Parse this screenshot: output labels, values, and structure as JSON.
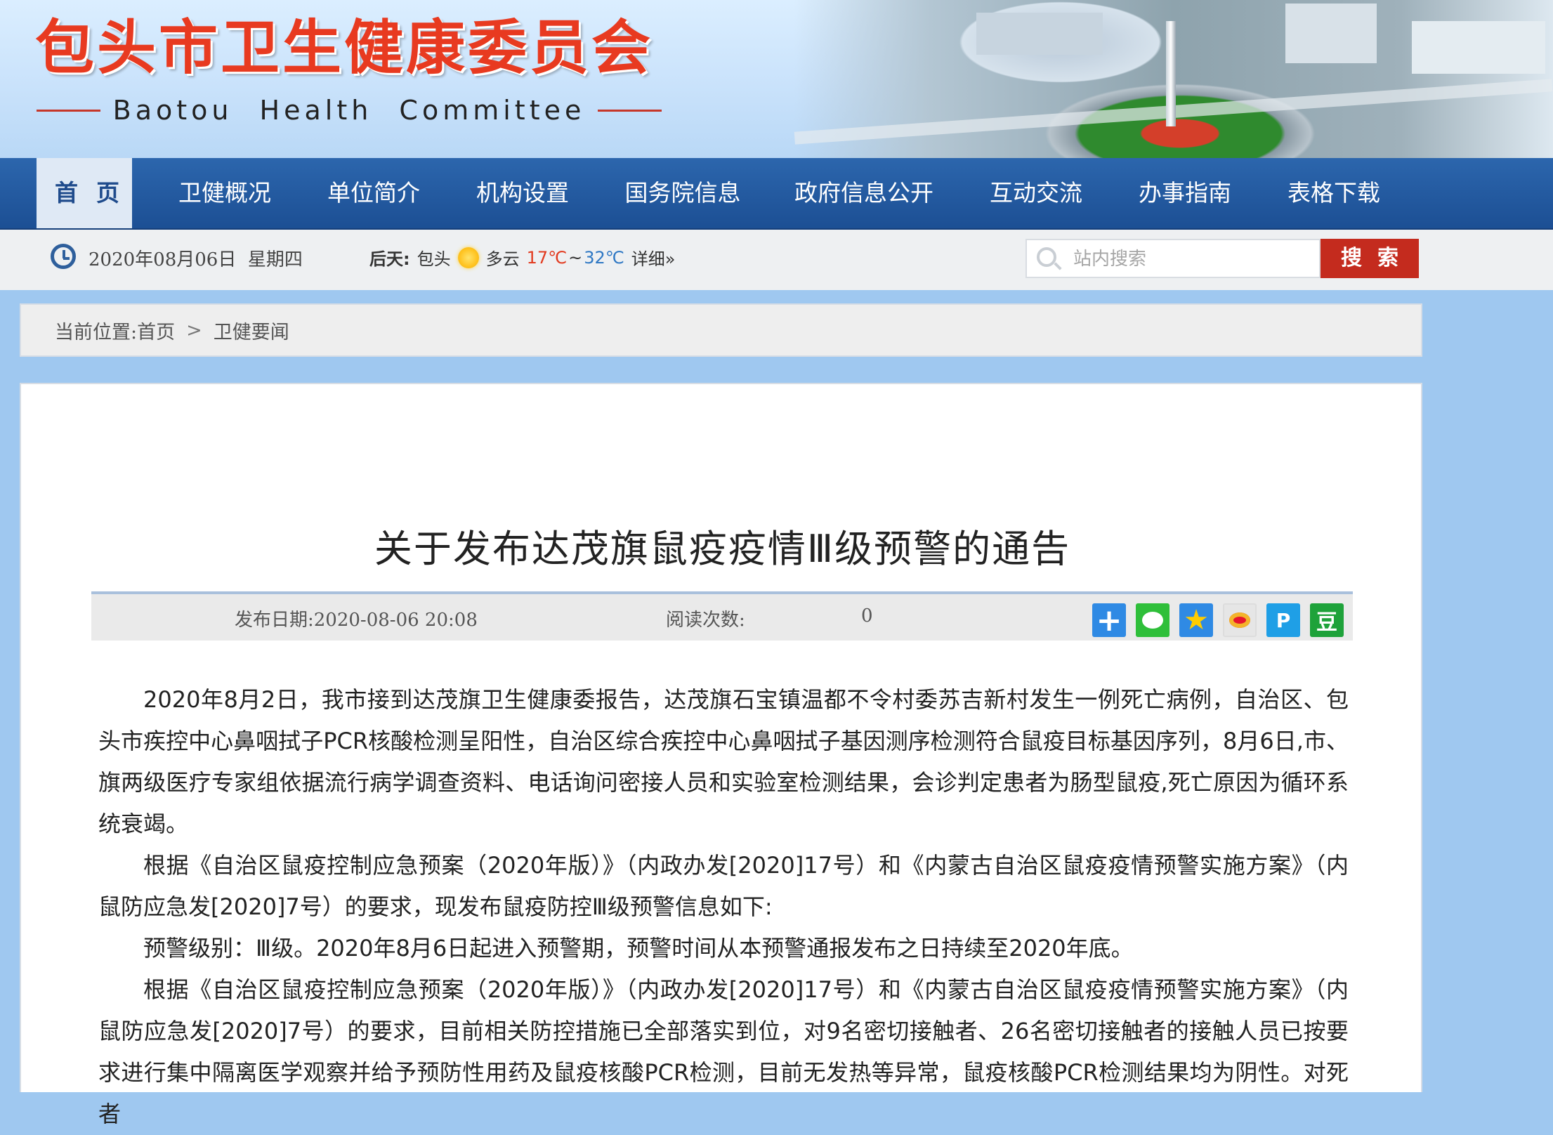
{
  "site": {
    "title_cn": "包头市卫生健康委员会",
    "title_en": "Baotou  Health  Committee"
  },
  "nav": {
    "items": [
      {
        "label": "首页",
        "active": true
      },
      {
        "label": "卫健概况"
      },
      {
        "label": "单位简介"
      },
      {
        "label": "机构设置"
      },
      {
        "label": "国务院信息"
      },
      {
        "label": "政府信息公开"
      },
      {
        "label": "互动交流"
      },
      {
        "label": "办事指南"
      },
      {
        "label": "表格下载"
      }
    ]
  },
  "info_bar": {
    "date": "2020年08月06日",
    "weekday": "星期四",
    "weather": {
      "day": "后天:",
      "city": "包头",
      "condition": "多云",
      "low": "17℃",
      "tilde": "~",
      "high": "32℃",
      "detail_link": "详细»"
    },
    "search": {
      "placeholder": "站内搜索",
      "button": "搜索"
    }
  },
  "breadcrumb": {
    "prefix": "当前位置:",
    "items": [
      "首页",
      "卫健要闻"
    ],
    "separator": ">"
  },
  "article": {
    "title": "关于发布达茂旗鼠疫疫情Ⅲ级预警的通告",
    "publish_label": "发布日期:",
    "publish_date": "2020-08-06 20:08",
    "read_label": "阅读次数:",
    "read_count": "0",
    "share_icons": [
      "more-share-icon",
      "wechat-icon",
      "qzone-icon",
      "weibo-icon",
      "tencent-weibo-icon",
      "douban-icon"
    ],
    "paragraphs": [
      "2020年8月2日，我市接到达茂旗卫生健康委报告，达茂旗石宝镇温都不令村委苏吉新村发生一例死亡病例，自治区、包头市疾控中心鼻咽拭子PCR核酸检测呈阳性，自治区综合疾控中心鼻咽拭子基因测序检测符合鼠疫目标基因序列，8月6日,市、旗两级医疗专家组依据流行病学调查资料、电话询问密接人员和实验室检测结果，会诊判定患者为肠型鼠疫,死亡原因为循环系统衰竭。",
      "根据《自治区鼠疫控制应急预案（2020年版）》（内政办发[2020]17号）和《内蒙古自治区鼠疫疫情预警实施方案》（内鼠防应急发[2020]7号）的要求，现发布鼠疫防控Ⅲ级预警信息如下:",
      "预警级别：Ⅲ级。2020年8月6日起进入预警期，预警时间从本预警通报发布之日持续至2020年底。",
      "根据《自治区鼠疫控制应急预案（2020年版）》（内政办发[2020]17号）和《内蒙古自治区鼠疫疫情预警实施方案》（内鼠防应急发[2020]7号）的要求，目前相关防控措施已全部落实到位，对9名密切接触者、26名密切接触者的接触人员已按要求进行集中隔离医学观察并给予预防性用药及鼠疫核酸PCR检测，目前无发热等异常，鼠疫核酸PCR检测结果均为阴性。对死者"
    ]
  },
  "colors": {
    "nav_blue": "#1c4f94",
    "title_red": "#e83a20",
    "search_red": "#c42b1e",
    "page_bg": "#9fc8f0"
  }
}
